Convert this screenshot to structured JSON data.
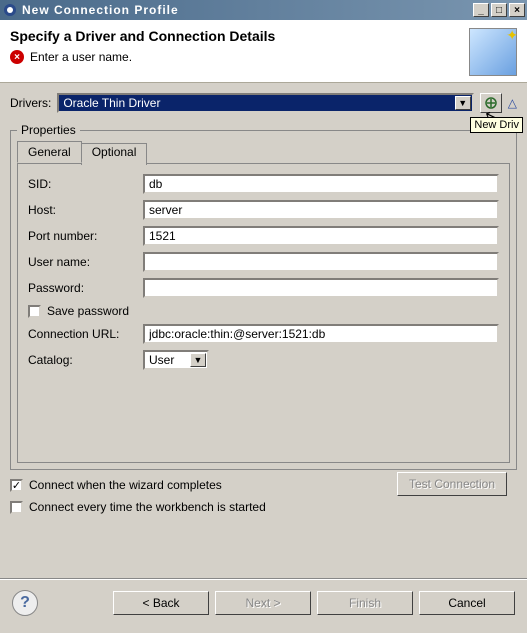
{
  "window": {
    "title": "New Connection Profile"
  },
  "header": {
    "title": "Specify a Driver and Connection Details",
    "error_message": "Enter a user name."
  },
  "drivers": {
    "label": "Drivers:",
    "selected": "Oracle Thin Driver",
    "tooltip": "New Driv"
  },
  "properties": {
    "legend": "Properties",
    "tabs": {
      "general": "General",
      "optional": "Optional"
    },
    "fields": {
      "sid_label": "SID:",
      "sid_value": "db",
      "host_label": "Host:",
      "host_value": "server",
      "port_label": "Port number:",
      "port_value": "1521",
      "user_label": "User name:",
      "user_value": "",
      "password_label": "Password:",
      "password_value": "",
      "save_password_label": "Save password",
      "url_label": "Connection URL:",
      "url_value": "jdbc:oracle:thin:@server:1521:db",
      "catalog_label": "Catalog:",
      "catalog_value": "User"
    }
  },
  "options": {
    "connect_on_complete": "Connect when the wizard completes",
    "connect_on_complete_checked": "✓",
    "connect_on_startup": "Connect every time the workbench is started",
    "test_connection": "Test Connection"
  },
  "buttons": {
    "back": "< Back",
    "next": "Next >",
    "finish": "Finish",
    "cancel": "Cancel"
  }
}
